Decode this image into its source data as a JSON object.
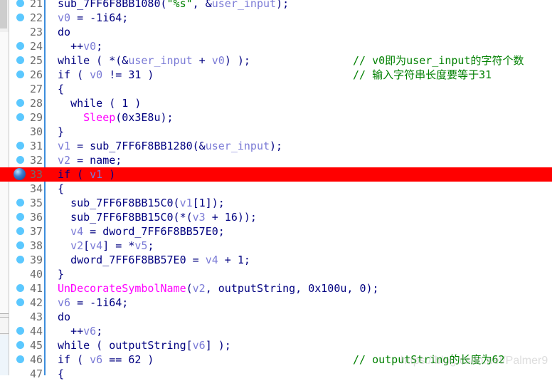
{
  "colors": {
    "keyword": "#000080",
    "variable": "#7b7bd6",
    "function": "#ff00ff",
    "string": "#008000",
    "comment": "#008000",
    "highlight": "#ff0000",
    "breakpoint_dot": "#5bc8ff"
  },
  "current_line": 33,
  "lines": [
    {
      "n": "21",
      "dot": true,
      "indent": 0,
      "t": [
        [
          "k",
          "sub_7FF6F8BB1080("
        ],
        [
          "s",
          "\"%s\""
        ],
        [
          "k",
          ", &"
        ],
        [
          "v",
          "user_input"
        ],
        [
          "k",
          ");"
        ]
      ]
    },
    {
      "n": "22",
      "dot": true,
      "indent": 0,
      "t": [
        [
          "v",
          "v0"
        ],
        [
          "k",
          " = -1i64;"
        ]
      ]
    },
    {
      "n": "23",
      "dot": false,
      "indent": 0,
      "t": [
        [
          "k",
          "do"
        ]
      ]
    },
    {
      "n": "24",
      "dot": true,
      "indent": 1,
      "t": [
        [
          "k",
          "++"
        ],
        [
          "v",
          "v0"
        ],
        [
          "k",
          ";"
        ]
      ]
    },
    {
      "n": "25",
      "dot": true,
      "indent": 0,
      "t": [
        [
          "k",
          "while ( *(&"
        ],
        [
          "v",
          "user_input"
        ],
        [
          "k",
          " + "
        ],
        [
          "v",
          "v0"
        ],
        [
          "k",
          ") );"
        ]
      ],
      "comment": "// v0即为user_input的字符个数"
    },
    {
      "n": "26",
      "dot": true,
      "indent": 0,
      "t": [
        [
          "k",
          "if ( "
        ],
        [
          "v",
          "v0"
        ],
        [
          "k",
          " != 31 )"
        ]
      ],
      "comment": "// 输入字符串长度要等于31"
    },
    {
      "n": "27",
      "dot": false,
      "indent": 0,
      "t": [
        [
          "k",
          "{"
        ]
      ]
    },
    {
      "n": "28",
      "dot": true,
      "indent": 1,
      "t": [
        [
          "k",
          "while ( 1 )"
        ]
      ]
    },
    {
      "n": "29",
      "dot": true,
      "indent": 2,
      "t": [
        [
          "f",
          "Sleep"
        ],
        [
          "k",
          "(0x3E8u);"
        ]
      ]
    },
    {
      "n": "30",
      "dot": false,
      "indent": 0,
      "t": [
        [
          "k",
          "}"
        ]
      ]
    },
    {
      "n": "31",
      "dot": true,
      "indent": 0,
      "t": [
        [
          "v",
          "v1"
        ],
        [
          "k",
          " = sub_7FF6F8BB1280(&"
        ],
        [
          "v",
          "user_input"
        ],
        [
          "k",
          ");"
        ]
      ]
    },
    {
      "n": "32",
      "dot": true,
      "indent": 0,
      "t": [
        [
          "v",
          "v2"
        ],
        [
          "k",
          " = name;"
        ]
      ]
    },
    {
      "n": "33",
      "dot": true,
      "indent": 0,
      "t": [
        [
          "k",
          "if ( "
        ],
        [
          "v",
          "v1"
        ],
        [
          "k",
          " )"
        ]
      ]
    },
    {
      "n": "34",
      "dot": false,
      "indent": 0,
      "t": [
        [
          "k",
          "{"
        ]
      ]
    },
    {
      "n": "35",
      "dot": true,
      "indent": 1,
      "t": [
        [
          "k",
          "sub_7FF6F8BB15C0("
        ],
        [
          "v",
          "v1"
        ],
        [
          "k",
          "[1]);"
        ]
      ]
    },
    {
      "n": "36",
      "dot": true,
      "indent": 1,
      "t": [
        [
          "k",
          "sub_7FF6F8BB15C0(*("
        ],
        [
          "v",
          "v3"
        ],
        [
          "k",
          " + 16));"
        ]
      ]
    },
    {
      "n": "37",
      "dot": true,
      "indent": 1,
      "t": [
        [
          "v",
          "v4"
        ],
        [
          "k",
          " = dword_7FF6F8BB57E0;"
        ]
      ]
    },
    {
      "n": "38",
      "dot": true,
      "indent": 1,
      "t": [
        [
          "v",
          "v2"
        ],
        [
          "k",
          "["
        ],
        [
          "v",
          "v4"
        ],
        [
          "k",
          "] = *"
        ],
        [
          "v",
          "v5"
        ],
        [
          "k",
          ";"
        ]
      ]
    },
    {
      "n": "39",
      "dot": true,
      "indent": 1,
      "t": [
        [
          "k",
          "dword_7FF6F8BB57E0 = "
        ],
        [
          "v",
          "v4"
        ],
        [
          "k",
          " + 1;"
        ]
      ]
    },
    {
      "n": "40",
      "dot": false,
      "indent": 0,
      "t": [
        [
          "k",
          "}"
        ]
      ]
    },
    {
      "n": "41",
      "dot": true,
      "indent": 0,
      "t": [
        [
          "f",
          "UnDecorateSymbolName"
        ],
        [
          "k",
          "("
        ],
        [
          "v",
          "v2"
        ],
        [
          "k",
          ", outputString, 0x100u, 0);"
        ]
      ]
    },
    {
      "n": "42",
      "dot": true,
      "indent": 0,
      "t": [
        [
          "v",
          "v6"
        ],
        [
          "k",
          " = -1i64;"
        ]
      ]
    },
    {
      "n": "43",
      "dot": false,
      "indent": 0,
      "t": [
        [
          "k",
          "do"
        ]
      ]
    },
    {
      "n": "44",
      "dot": true,
      "indent": 1,
      "t": [
        [
          "k",
          "++"
        ],
        [
          "v",
          "v6"
        ],
        [
          "k",
          ";"
        ]
      ]
    },
    {
      "n": "45",
      "dot": true,
      "indent": 0,
      "t": [
        [
          "k",
          "while ( outputString["
        ],
        [
          "v",
          "v6"
        ],
        [
          "k",
          "] );"
        ]
      ]
    },
    {
      "n": "46",
      "dot": true,
      "indent": 0,
      "t": [
        [
          "k",
          "if ( "
        ],
        [
          "v",
          "v6"
        ],
        [
          "k",
          " == 62 )"
        ]
      ],
      "comment": "// outputString的长度为62"
    },
    {
      "n": "47",
      "dot": false,
      "indent": 0,
      "t": [
        [
          "k",
          "{"
        ]
      ]
    }
  ],
  "watermark": "https://blog.csdn.net/Palmer9"
}
